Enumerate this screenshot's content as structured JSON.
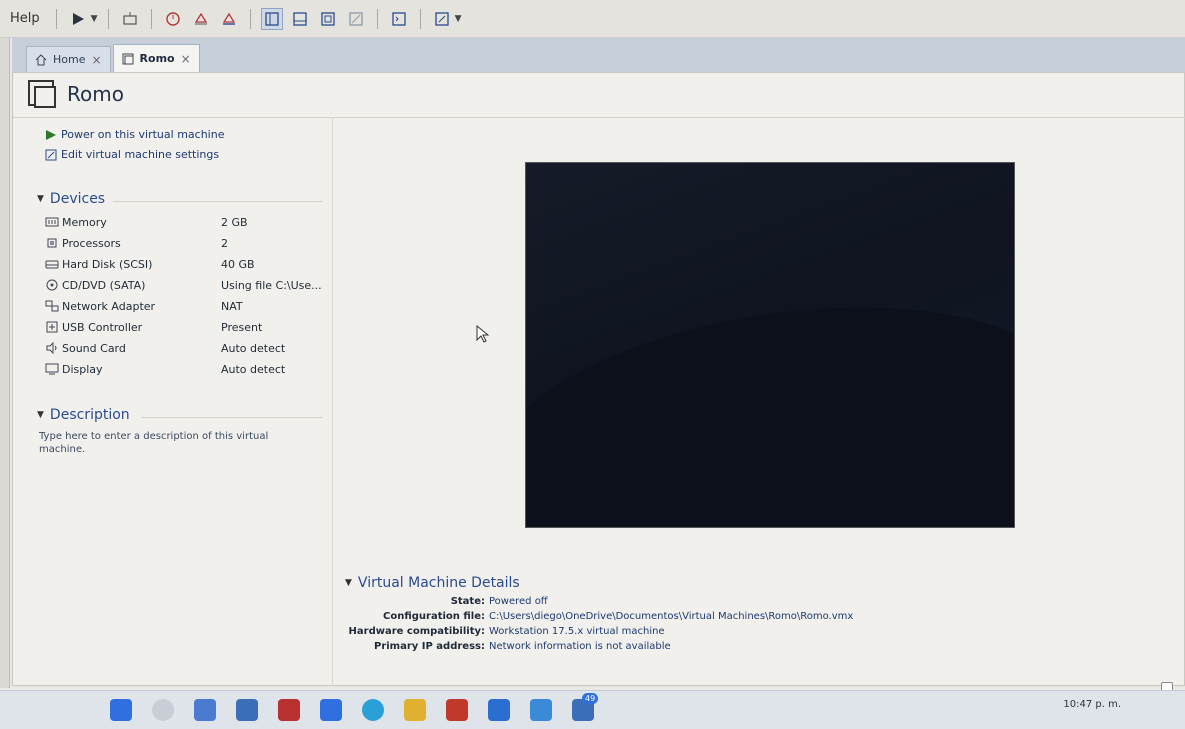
{
  "menu": {
    "help": "Help"
  },
  "tabs": [
    {
      "label": "Home",
      "close": "×"
    },
    {
      "label": "Romo",
      "close": "×"
    }
  ],
  "vm": {
    "title": "Romo"
  },
  "actions": {
    "power_on": "Power on this virtual machine",
    "edit_settings": "Edit virtual machine settings"
  },
  "devices": {
    "heading": "Devices",
    "items": [
      {
        "name": "Memory",
        "value": "2 GB",
        "icon": "memory-icon"
      },
      {
        "name": "Processors",
        "value": "2",
        "icon": "processor-icon"
      },
      {
        "name": "Hard Disk (SCSI)",
        "value": "40 GB",
        "icon": "hard-disk-icon"
      },
      {
        "name": "CD/DVD (SATA)",
        "value": "Using file C:\\Use...",
        "icon": "cd-dvd-icon"
      },
      {
        "name": "Network Adapter",
        "value": "NAT",
        "icon": "network-adapter-icon"
      },
      {
        "name": "USB Controller",
        "value": "Present",
        "icon": "usb-controller-icon"
      },
      {
        "name": "Sound Card",
        "value": "Auto detect",
        "icon": "sound-card-icon"
      },
      {
        "name": "Display",
        "value": "Auto detect",
        "icon": "display-icon"
      }
    ]
  },
  "description": {
    "heading": "Description",
    "placeholder": "Type here to enter a description of this virtual machine."
  },
  "details": {
    "heading": "Virtual Machine Details",
    "rows": [
      {
        "label": "State:",
        "value": "Powered off"
      },
      {
        "label": "Configuration file:",
        "value": "C:\\Users\\diego\\OneDrive\\Documentos\\Virtual Machines\\Romo\\Romo.vmx"
      },
      {
        "label": "Hardware compatibility:",
        "value": "Workstation 17.5.x virtual machine"
      },
      {
        "label": "Primary IP address:",
        "value": "Network information is not available"
      }
    ]
  },
  "taskbar": {
    "badge_count": "49",
    "clock": "10:47 p. m."
  },
  "colors": {
    "accent": "#2a4b8e",
    "link": "#1e3a70",
    "tabstrip": "#c7cfdb"
  }
}
